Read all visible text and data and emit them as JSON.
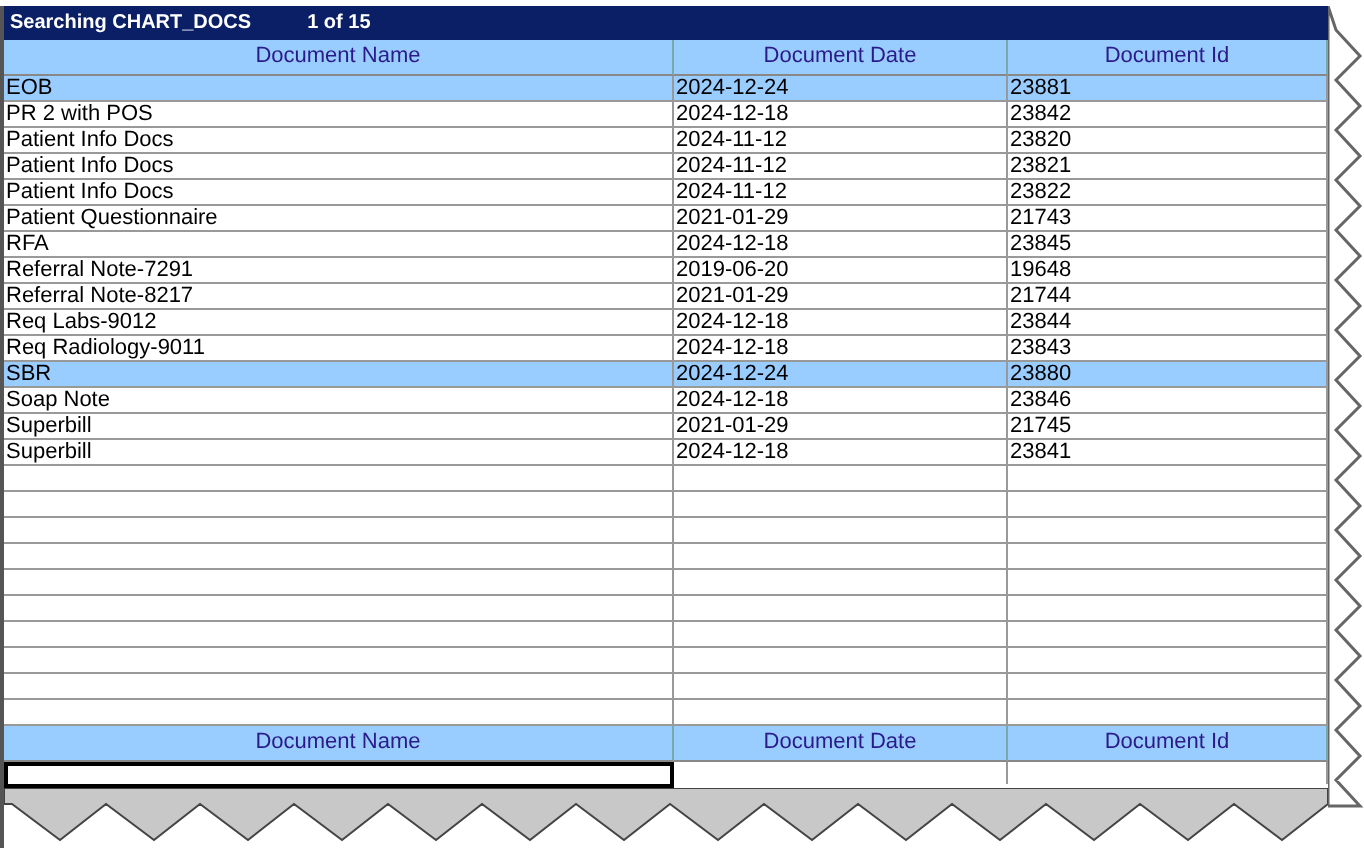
{
  "title_bar": {
    "title": "Searching CHART_DOCS",
    "counter": "1 of 15"
  },
  "table": {
    "columns": [
      "Document Name",
      "Document Date",
      "Document Id"
    ],
    "rows": [
      {
        "cells": [
          "EOB",
          "2024-12-24",
          "23881"
        ],
        "selected": true
      },
      {
        "cells": [
          "PR 2 with POS",
          "2024-12-18",
          "23842"
        ],
        "selected": false
      },
      {
        "cells": [
          "Patient Info Docs",
          "2024-11-12",
          "23820"
        ],
        "selected": false
      },
      {
        "cells": [
          "Patient Info Docs",
          "2024-11-12",
          "23821"
        ],
        "selected": false
      },
      {
        "cells": [
          "Patient Info Docs",
          "2024-11-12",
          "23822"
        ],
        "selected": false
      },
      {
        "cells": [
          "Patient Questionnaire",
          "2021-01-29",
          "21743"
        ],
        "selected": false
      },
      {
        "cells": [
          "RFA",
          "2024-12-18",
          "23845"
        ],
        "selected": false
      },
      {
        "cells": [
          "Referral Note-7291",
          "2019-06-20",
          "19648"
        ],
        "selected": false
      },
      {
        "cells": [
          "Referral Note-8217",
          "2021-01-29",
          "21744"
        ],
        "selected": false
      },
      {
        "cells": [
          "Req Labs-9012",
          "2024-12-18",
          "23844"
        ],
        "selected": false
      },
      {
        "cells": [
          "Req Radiology-9011",
          "2024-12-18",
          "23843"
        ],
        "selected": false
      },
      {
        "cells": [
          "SBR",
          "2024-12-24",
          "23880"
        ],
        "selected": true
      },
      {
        "cells": [
          "Soap Note",
          "2024-12-18",
          "23846"
        ],
        "selected": false
      },
      {
        "cells": [
          "Superbill",
          "2021-01-29",
          "21745"
        ],
        "selected": false
      },
      {
        "cells": [
          "Superbill",
          "2024-12-18",
          "23841"
        ],
        "selected": false
      }
    ]
  },
  "filter": {
    "columns": [
      "Document Name",
      "Document Date",
      "Document Id"
    ],
    "fields": [
      {
        "focused": true
      },
      {
        "focused": false
      },
      {
        "focused": false
      }
    ]
  }
}
